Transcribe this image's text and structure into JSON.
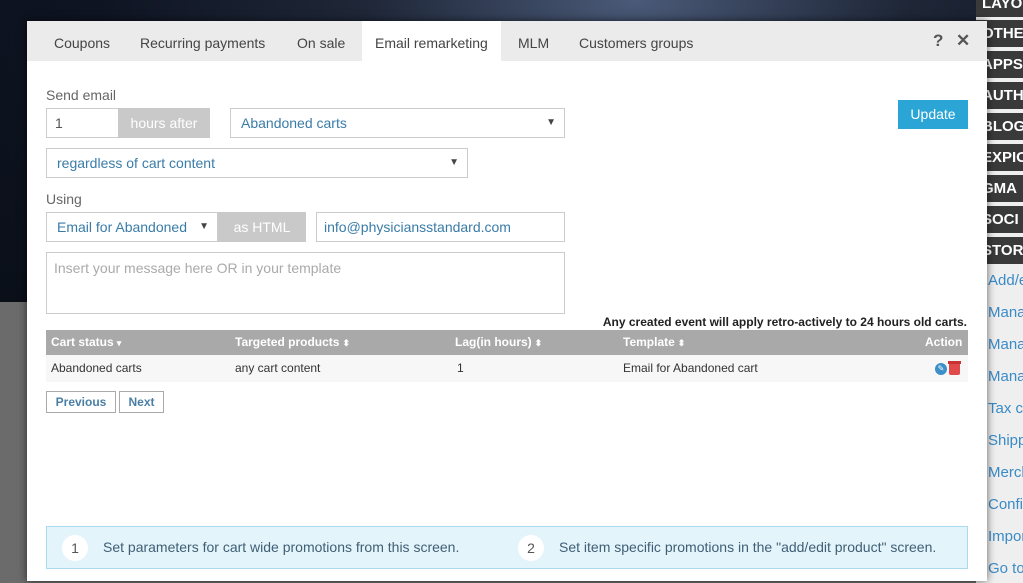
{
  "tabs": [
    {
      "label": "Coupons"
    },
    {
      "label": "Recurring payments"
    },
    {
      "label": "On sale"
    },
    {
      "label": "Email remarketing"
    },
    {
      "label": "MLM"
    },
    {
      "label": "Customers groups"
    }
  ],
  "active_tab": "Email remarketing",
  "icons": {
    "help": "?",
    "close": "✕"
  },
  "form": {
    "send_email_label": "Send email",
    "hours_value": "1",
    "hours_after_addon": "hours after",
    "trigger_select": "Abandoned carts",
    "content_select": "regardless of cart content",
    "using_label": "Using",
    "template_select": "Email for Abandoned",
    "format_addon": "as HTML",
    "sender_email": "info@physiciansstandard.com",
    "message_placeholder": "Insert your message here OR in your template",
    "update_button": "Update"
  },
  "note": "Any created event will apply retro-actively to 24 hours old carts.",
  "table": {
    "headers": [
      {
        "label": "Cart status",
        "sort": "▾"
      },
      {
        "label": "Targeted products",
        "sort": "⬍"
      },
      {
        "label": "Lag(in hours)",
        "sort": "⬍"
      },
      {
        "label": "Template",
        "sort": "⬍"
      },
      {
        "label": "Action",
        "sort": ""
      }
    ],
    "rows": [
      {
        "cart_status": "Abandoned carts",
        "targeted_products": "any cart content",
        "lag": "1",
        "template": "Email for Abandoned cart"
      }
    ]
  },
  "pagination": {
    "previous": "Previous",
    "next": "Next"
  },
  "info": [
    {
      "num": "1",
      "text": "Set parameters for cart wide promotions from this screen."
    },
    {
      "num": "2",
      "text": "Set item specific promotions in the \"add/edit product\" screen."
    }
  ],
  "right_sidebar": {
    "dark_items": [
      "LAYO",
      "OTHE",
      "APPS",
      "AUTH",
      "BLOG",
      "EXPIO",
      "GMA",
      "SOCI",
      "STOR"
    ],
    "link_items": [
      "Add/e",
      "Mana",
      "Mana",
      "Mana",
      "Tax co",
      "Shipp",
      "Merch",
      "Config",
      "Impor",
      "Go to"
    ]
  }
}
